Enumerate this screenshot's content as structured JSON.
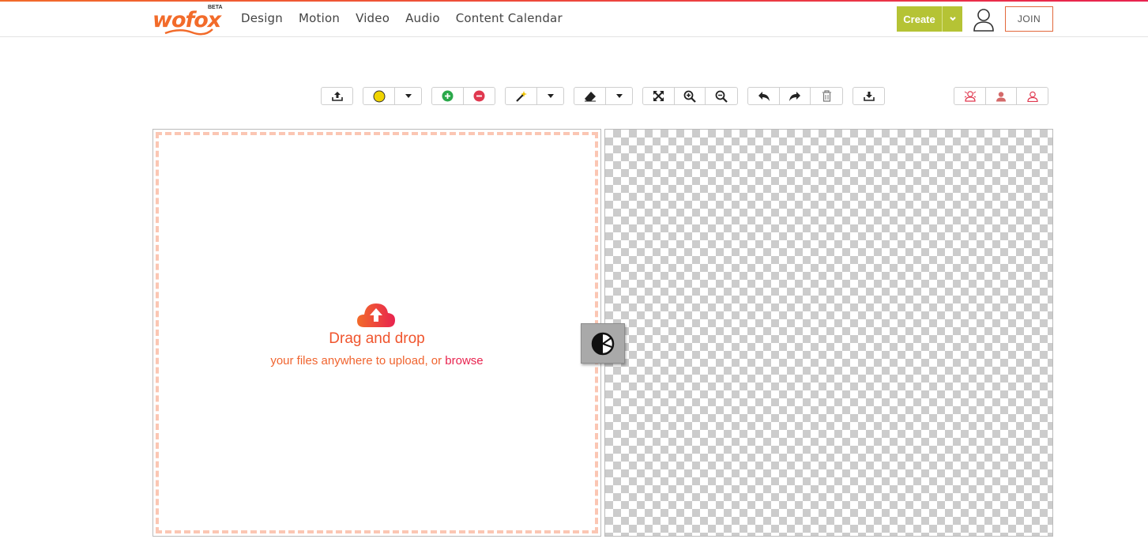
{
  "brand": {
    "name": "wofox",
    "badge": "BETA",
    "color": "#f26b2a"
  },
  "nav": {
    "items": [
      "Design",
      "Motion",
      "Video",
      "Audio",
      "Content Calendar"
    ]
  },
  "header": {
    "create_label": "Create",
    "join_label": "JOIN",
    "create_color": "#b5c335"
  },
  "toolbar": {
    "icons": [
      "upload-icon",
      "brush-color-icon",
      "dropdown-caret-icon",
      "add-icon",
      "remove-icon",
      "magic-wand-icon",
      "eraser-icon",
      "fit-screen-icon",
      "zoom-in-icon",
      "zoom-out-icon",
      "undo-icon",
      "redo-icon",
      "trash-icon",
      "download-icon",
      "person-outline-icon",
      "person-filled-icon",
      "person-icon"
    ],
    "brush_color": "#f0d400",
    "add_color": "#2aa84a",
    "remove_color": "#e0384f"
  },
  "dropzone": {
    "title": "Drag and drop",
    "subtitle_prefix": "your files anywhere to upload, or ",
    "subtitle_link": "browse"
  }
}
